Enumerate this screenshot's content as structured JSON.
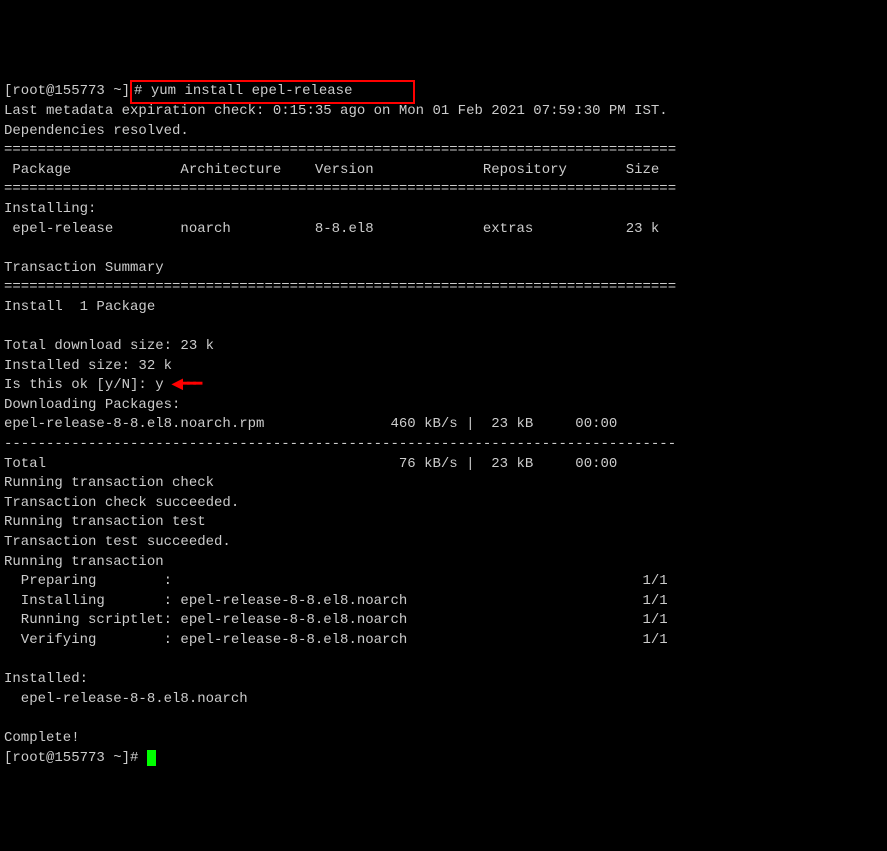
{
  "prompt_prefix": "[root@155773 ~]",
  "prompt_hash": "# ",
  "command": "yum install epel-release",
  "line_metadata": "Last metadata expiration check: 0:15:35 ago on Mon 01 Feb 2021 07:59:30 PM IST.",
  "line_deps": "Dependencies resolved.",
  "sep_eq": "================================================================================",
  "sep_dash": "--------------------------------------------------------------------------------",
  "header_row": " Package             Architecture    Version             Repository       Size",
  "section_installing": "Installing:",
  "pkg_row": " epel-release        noarch          8-8.el8             extras           23 k",
  "transaction_summary": "Transaction Summary",
  "install_count": "Install  1 Package",
  "total_download": "Total download size: 23 k",
  "installed_size": "Installed size: 32 k",
  "confirm_prompt": "Is this ok [y/N]: ",
  "confirm_value": "y ",
  "downloading": "Downloading Packages:",
  "download_row": "epel-release-8-8.el8.noarch.rpm               460 kB/s |  23 kB     00:00",
  "total_row": "Total                                          76 kB/s |  23 kB     00:00",
  "running_check": "Running transaction check",
  "check_succeeded": "Transaction check succeeded.",
  "running_test": "Running transaction test",
  "test_succeeded": "Transaction test succeeded.",
  "running_transaction": "Running transaction",
  "step_preparing": "  Preparing        :                                                        1/1",
  "step_installing": "  Installing       : epel-release-8-8.el8.noarch                            1/1",
  "step_scriptlet": "  Running scriptlet: epel-release-8-8.el8.noarch                            1/1",
  "step_verifying": "  Verifying        : epel-release-8-8.el8.noarch                            1/1",
  "installed_header": "Installed:",
  "installed_pkg": "  epel-release-8-8.el8.noarch",
  "complete": "Complete!",
  "final_prompt": "[root@155773 ~]# "
}
